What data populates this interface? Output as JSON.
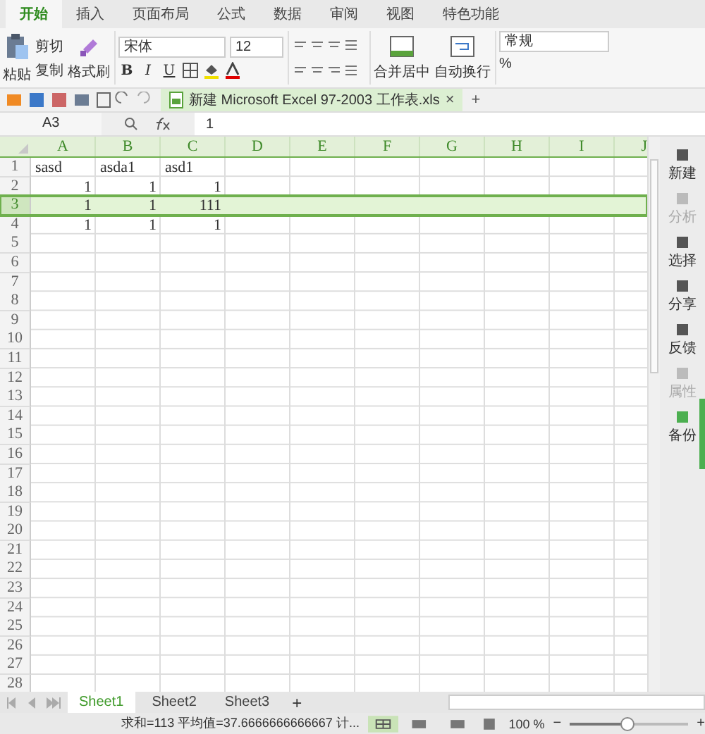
{
  "menu_tabs": [
    {
      "label": "开始",
      "selected": true
    },
    {
      "label": "插入",
      "selected": false
    },
    {
      "label": "页面布局",
      "selected": false
    },
    {
      "label": "公式",
      "selected": false
    },
    {
      "label": "数据",
      "selected": false
    },
    {
      "label": "审阅",
      "selected": false
    },
    {
      "label": "视图",
      "selected": false
    },
    {
      "label": "特色功能",
      "selected": false
    }
  ],
  "ribbon": {
    "paste": "粘贴",
    "cut": "剪切",
    "copy": "复制",
    "format_painter": "格式刷",
    "font": "宋体",
    "font_size": "12",
    "bold": "B",
    "italic": "I",
    "underline": "U",
    "merge": "合并居中",
    "wrap": "自动换行",
    "number_format": "常规",
    "percent": "%"
  },
  "document_tab": {
    "title": "新建 Microsoft Excel 97-2003 工作表.xls",
    "close": "×",
    "add": "+"
  },
  "formula_bar": {
    "name_box": "A3",
    "value": "1"
  },
  "sheet": {
    "columns": [
      "A",
      "B",
      "C",
      "D",
      "E",
      "F",
      "G",
      "H",
      "I",
      "J"
    ],
    "rows": [
      {
        "header": "1",
        "selected": false,
        "cells": [
          {
            "value": "sasd",
            "kind": "text"
          },
          {
            "value": "asda1",
            "kind": "text"
          },
          {
            "value": "asd1",
            "kind": "text"
          }
        ]
      },
      {
        "header": "2",
        "selected": false,
        "cells": [
          {
            "value": "1",
            "kind": "number"
          },
          {
            "value": "1",
            "kind": "number"
          },
          {
            "value": "1",
            "kind": "number"
          }
        ]
      },
      {
        "header": "3",
        "selected": true,
        "cells": [
          {
            "value": "1",
            "kind": "number"
          },
          {
            "value": "1",
            "kind": "number"
          },
          {
            "value": "111",
            "kind": "number"
          }
        ]
      },
      {
        "header": "4",
        "selected": false,
        "cells": [
          {
            "value": "1",
            "kind": "number"
          },
          {
            "value": "1",
            "kind": "number"
          },
          {
            "value": "1",
            "kind": "number"
          }
        ]
      },
      {
        "header": "5",
        "selected": false
      },
      {
        "header": "6",
        "selected": false
      },
      {
        "header": "7",
        "selected": false
      },
      {
        "header": "8",
        "selected": false
      },
      {
        "header": "9",
        "selected": false
      },
      {
        "header": "10",
        "selected": false
      },
      {
        "header": "11",
        "selected": false
      },
      {
        "header": "12",
        "selected": false
      },
      {
        "header": "13",
        "selected": false
      },
      {
        "header": "14",
        "selected": false
      },
      {
        "header": "15",
        "selected": false
      },
      {
        "header": "16",
        "selected": false
      },
      {
        "header": "17",
        "selected": false
      },
      {
        "header": "18",
        "selected": false
      },
      {
        "header": "19",
        "selected": false
      },
      {
        "header": "20",
        "selected": false
      },
      {
        "header": "21",
        "selected": false
      },
      {
        "header": "22",
        "selected": false
      },
      {
        "header": "23",
        "selected": false
      },
      {
        "header": "24",
        "selected": false
      },
      {
        "header": "25",
        "selected": false
      },
      {
        "header": "26",
        "selected": false
      },
      {
        "header": "27",
        "selected": false
      },
      {
        "header": "28",
        "selected": false
      }
    ]
  },
  "side_panel": [
    {
      "label": "新建",
      "disabled": false
    },
    {
      "label": "分析",
      "disabled": true
    },
    {
      "label": "选择",
      "disabled": false
    },
    {
      "label": "分享",
      "disabled": false
    },
    {
      "label": "反馈",
      "disabled": false
    },
    {
      "label": "属性",
      "disabled": true
    },
    {
      "label": "备份",
      "disabled": false
    }
  ],
  "sheet_tabs": [
    {
      "label": "Sheet1",
      "selected": true
    },
    {
      "label": "Sheet2",
      "selected": false
    },
    {
      "label": "Sheet3",
      "selected": false
    }
  ],
  "add_sheet": "+",
  "status_bar": {
    "summary": "求和=113 平均值=37.6666666666667 计...",
    "zoom": "100 %",
    "zoom_out": "−",
    "zoom_in": "+",
    "zoom_slider": {
      "level": 0.47
    }
  }
}
